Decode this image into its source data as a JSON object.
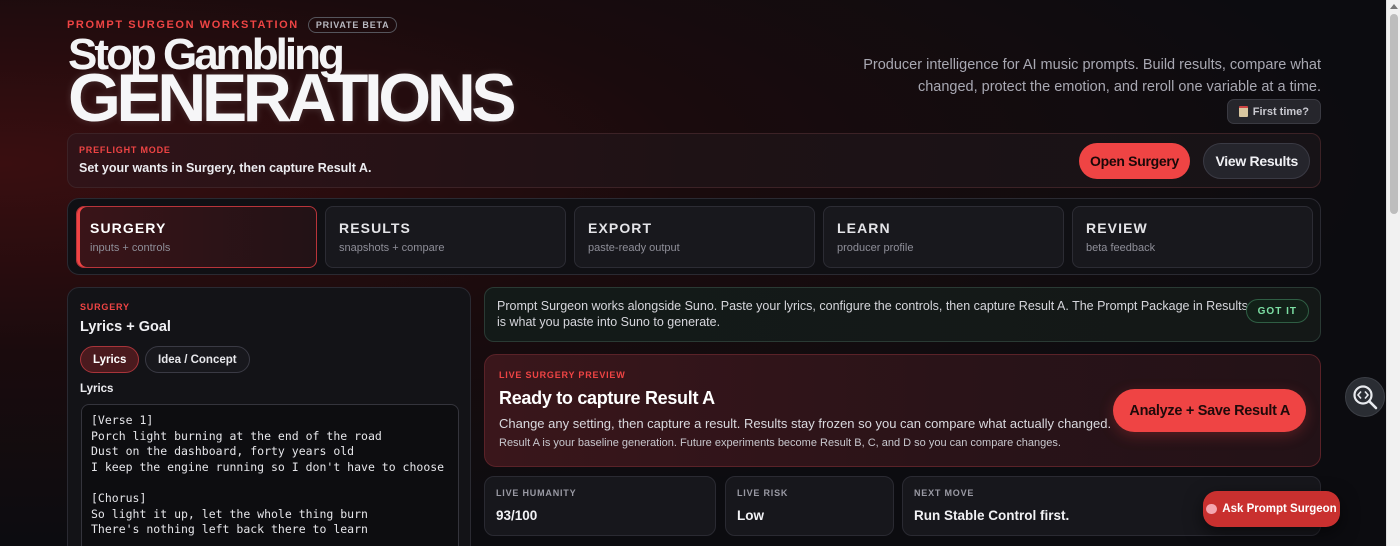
{
  "header": {
    "kicker": "PROMPT SURGEON WORKSTATION",
    "beta_badge": "PRIVATE BETA",
    "hero_line1": "Stop Gambling",
    "hero_line2": "GENERATIONS",
    "tagline": "Producer intelligence for AI music prompts. Build results, compare what changed, protect the emotion, and reroll one variable at a time.",
    "first_time_label": "First time?"
  },
  "preflight": {
    "kicker": "PREFLIGHT MODE",
    "text": "Set your wants in Surgery, then capture Result A.",
    "open_surgery_label": "Open Surgery",
    "view_results_label": "View Results"
  },
  "tabs": [
    {
      "title": "SURGERY",
      "sub": "inputs + controls",
      "active": true
    },
    {
      "title": "RESULTS",
      "sub": "snapshots + compare",
      "active": false
    },
    {
      "title": "EXPORT",
      "sub": "paste-ready output",
      "active": false
    },
    {
      "title": "LEARN",
      "sub": "producer profile",
      "active": false
    },
    {
      "title": "REVIEW",
      "sub": "beta feedback",
      "active": false
    }
  ],
  "surgery": {
    "kicker": "SURGERY",
    "title": "Lyrics + Goal",
    "mode_lyrics": "Lyrics",
    "mode_idea": "Idea / Concept",
    "lyrics_label": "Lyrics",
    "lyrics_value": "[Verse 1]\nPorch light burning at the end of the road\nDust on the dashboard, forty years old\nI keep the engine running so I don't have to choose\n\n[Chorus]\nSo light it up, let the whole thing burn\nThere's nothing left back there to learn"
  },
  "notice": {
    "text": "Prompt Surgeon works alongside Suno. Paste your lyrics, configure the controls, then capture Result A. The Prompt Package in Results is what you paste into Suno to generate.",
    "got_it_label": "GOT IT"
  },
  "preview": {
    "kicker": "LIVE SURGERY PREVIEW",
    "title": "Ready to capture Result A",
    "desc": "Change any setting, then capture a result. Results stay frozen so you can compare what actually changed.",
    "note": "Result A is your baseline generation. Future experiments become Result B, C, and D so you can compare changes.",
    "analyze_label": "Analyze + Save Result A"
  },
  "stats": [
    {
      "label": "LIVE HUMANITY",
      "value": "93/100"
    },
    {
      "label": "LIVE RISK",
      "value": "Low"
    },
    {
      "label": "NEXT MOVE",
      "value": "Run Stable Control first."
    }
  ],
  "ask_label": "Ask Prompt Surgeon",
  "colors": {
    "accent": "#ef4444",
    "success": "#7de0a4",
    "background": "#0c0c10"
  }
}
